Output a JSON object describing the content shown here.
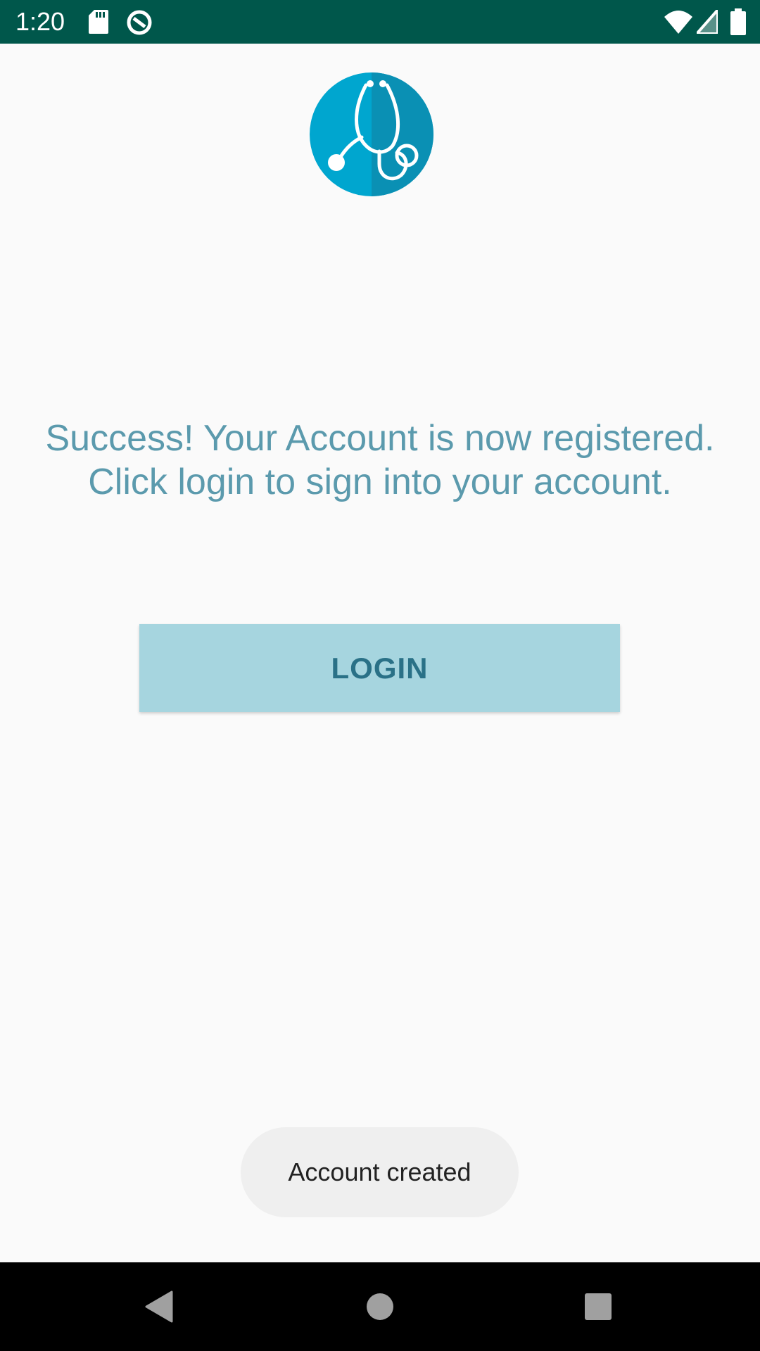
{
  "status_bar": {
    "time": "1:20",
    "icons": [
      "sd-card-icon",
      "data-saver-icon",
      "wifi-icon",
      "cell-signal-icon",
      "battery-icon"
    ],
    "background_color": "#00574b"
  },
  "logo": {
    "icon": "stethoscope-icon",
    "color": "#00a6cf"
  },
  "message": {
    "line1": "Success! Your Account is now registered.",
    "line2": "Click login to sign into your account.",
    "color": "#5b9aad"
  },
  "login_button": {
    "label": "LOGIN",
    "background_color": "#a6d5df",
    "text_color": "#2a7187"
  },
  "toast": {
    "text": "Account created"
  },
  "nav_bar": {
    "buttons": [
      "back-icon",
      "home-icon",
      "recents-icon"
    ]
  }
}
